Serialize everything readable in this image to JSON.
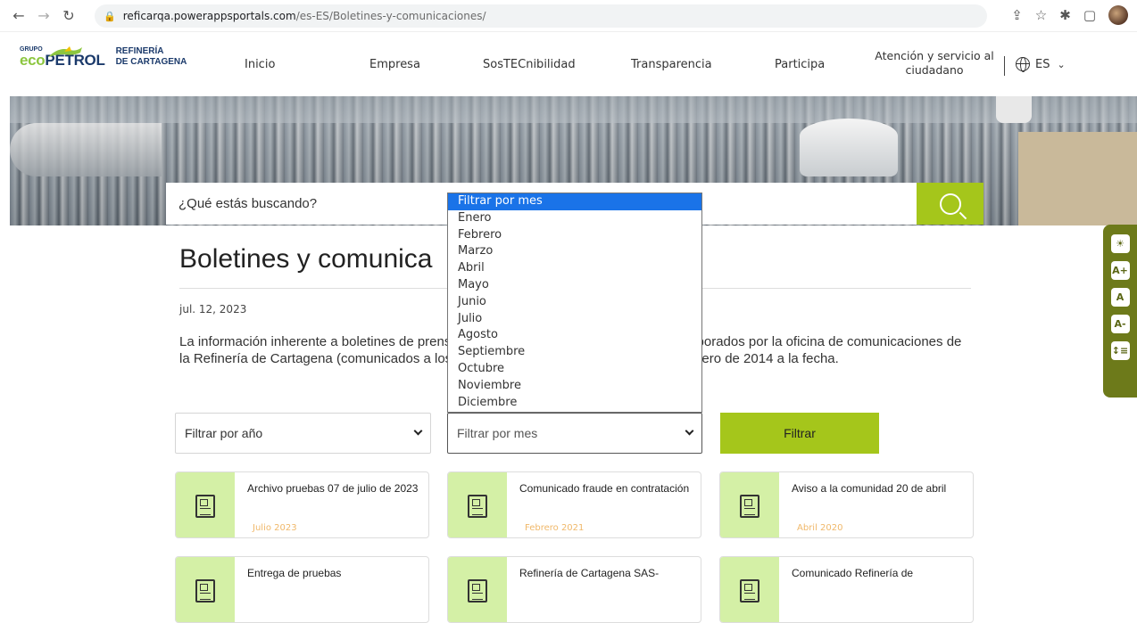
{
  "browser": {
    "url_host": "reficarqa.powerappsportals.com",
    "url_path": "/es-ES/Boletines-y-comunicaciones/"
  },
  "logo": {
    "grupo": "GRUPO",
    "ecopetrol_a": "eco",
    "ecopetrol_b": "PETROL",
    "refineria_line1": "REFINERÍA",
    "refineria_line2": "DE CARTAGENA"
  },
  "nav": {
    "items": [
      "Inicio",
      "Empresa",
      "SosTECnibilidad",
      "Transparencia",
      "Participa"
    ],
    "atencion": "Atención y servicio al ciudadano",
    "lang": "ES"
  },
  "search": {
    "placeholder": "¿Qué estás buscando?"
  },
  "page": {
    "title": "Boletines y comunica",
    "date": "jul. 12, 2023",
    "description": "La información inherente a boletines de prensa, comunicados e información pública elaborados por la oficina de comunicaciones de la Refinería de Cartagena (comunicados a los medios) puede ser consultada aquí de enero de 2014 a la fecha."
  },
  "filters": {
    "year_label": "Filtrar por año",
    "month_label": "Filtrar por mes",
    "button": "Filtrar"
  },
  "month_dropdown": {
    "options": [
      "Filtrar por mes",
      "Enero",
      "Febrero",
      "Marzo",
      "Abril",
      "Mayo",
      "Junio",
      "Julio",
      "Agosto",
      "Septiembre",
      "Octubre",
      "Noviembre",
      "Diciembre"
    ],
    "selected_index": 0
  },
  "cards": [
    {
      "title": "Archivo pruebas 07 de julio de 2023",
      "date": "Julio 2023"
    },
    {
      "title": "Comunicado fraude en contratación",
      "date": "Febrero 2021"
    },
    {
      "title": "Aviso a la comunidad 20 de abril",
      "date": "Abril 2020"
    },
    {
      "title": "Entrega de pruebas",
      "date": ""
    },
    {
      "title": "Refinería de Cartagena SAS-",
      "date": ""
    },
    {
      "title": "Comunicado Refinería de",
      "date": ""
    }
  ],
  "accessibility": [
    "☀",
    "A+",
    "A",
    "A-",
    "↕≡"
  ],
  "colors": {
    "accent_green": "#a5c61b",
    "card_thumb": "#d4f0a6",
    "widget": "#6d7a1a",
    "card_date": "#f0b86a",
    "select_highlight": "#1a73e8"
  }
}
